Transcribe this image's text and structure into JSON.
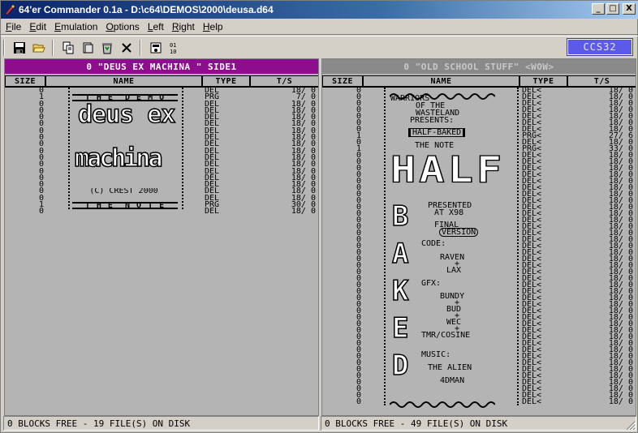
{
  "window": {
    "title": "64'er Commander 0.1a - D:\\c64\\DEMOS\\2000\\deusa.d64",
    "min": "_",
    "max": "□",
    "close": "X"
  },
  "menu": [
    "File",
    "Edit",
    "Emulation",
    "Options",
    "Left",
    "Right",
    "Help"
  ],
  "toolbar": {
    "badge": "CCS32"
  },
  "left": {
    "title": "0 \"DEUS EX MACHINA \" SIDE1",
    "headers": {
      "size": "SIZE",
      "name": "NAME",
      "type": "TYPE",
      "ts": "T/S"
    },
    "rows": [
      {
        "size": "0",
        "name": "",
        "type": "DEL",
        "ts": "18/ 0"
      },
      {
        "size": "1",
        "name": "T_H_E__D_E_M_O",
        "type": "PRG",
        "ts": "7/ 0"
      },
      {
        "size": "0",
        "name": "",
        "type": "DEL",
        "ts": "18/ 0"
      },
      {
        "size": "0",
        "name": "",
        "type": "DEL",
        "ts": "18/ 0"
      },
      {
        "size": "0",
        "name": "",
        "type": "DEL",
        "ts": "18/ 0"
      },
      {
        "size": "0",
        "name": "",
        "type": "DEL",
        "ts": "18/ 0"
      },
      {
        "size": "0",
        "name": "",
        "type": "DEL",
        "ts": "18/ 0"
      },
      {
        "size": "0",
        "name": "",
        "type": "DEL",
        "ts": "18/ 0"
      },
      {
        "size": "0",
        "name": "",
        "type": "DEL",
        "ts": "18/ 0"
      },
      {
        "size": "0",
        "name": "",
        "type": "DEL",
        "ts": "18/ 0"
      },
      {
        "size": "0",
        "name": "",
        "type": "DEL",
        "ts": "18/ 0"
      },
      {
        "size": "0",
        "name": "",
        "type": "DEL",
        "ts": "18/ 0"
      },
      {
        "size": "0",
        "name": "",
        "type": "DEL",
        "ts": "18/ 0"
      },
      {
        "size": "0",
        "name": "",
        "type": "DEL",
        "ts": "18/ 0"
      },
      {
        "size": "0",
        "name": "",
        "type": "DEL",
        "ts": "18/ 0"
      },
      {
        "size": "0",
        "name": "(C) CREST 2000",
        "type": "DEL",
        "ts": "18/ 0"
      },
      {
        "size": "0",
        "name": "",
        "type": "DEL",
        "ts": "18/ 0"
      },
      {
        "size": "1",
        "name": "T_H_E__N_O_T_E",
        "type": "PRG",
        "ts": "30/ 0"
      },
      {
        "size": "0",
        "name": "",
        "type": "DEL",
        "ts": "18/ 0"
      }
    ],
    "logo_top": "deus ex",
    "logo_bottom": "machina",
    "status": "0 BLOCKS FREE - 19 FILE(S) ON DISK"
  },
  "right": {
    "title": "0 \"OLD SCHOOL STUFF\" <WOW>",
    "headers": {
      "size": "SIZE",
      "name": "NAME",
      "type": "TYPE",
      "ts": "T/S"
    },
    "texts": {
      "l1": "WARRIORS",
      "l2": "OF THE",
      "l3": "WASTELAND",
      "l4": "PRESENTS:",
      "l5": "HALF-BAKED",
      "l6": "THE NOTE",
      "big": "HALF",
      "p1": "PRESENTED",
      "p2": "AT X98",
      "f1": "FINAL",
      "f2": "VERSION",
      "code": "CODE:",
      "raven": "RAVEN",
      "plus1": "+",
      "lax": "LAX",
      "gfx": "GFX:",
      "bundy": "BUNDY",
      "plus2": "+",
      "bud": "BUD",
      "plus3": "+",
      "wec": "WEC",
      "plus4": "+",
      "tmr": "TMR/COSINE",
      "music": "MUSIC:",
      "alien": "THE ALIEN",
      "dman": "4DMAN",
      "baked": "BAKED"
    },
    "ts_list": [
      "18/ 0",
      "18/ 0",
      "18/ 0",
      "18/ 0",
      "18/ 0",
      "18/ 0",
      "18/ 0",
      "27/ 6",
      "18/ 0",
      "33/ 0",
      "18/ 0",
      "18/ 0",
      "18/ 0",
      "18/ 0",
      "18/ 0",
      "18/ 0",
      "18/ 0",
      "18/ 0",
      "18/ 0",
      "18/ 0",
      "18/ 0",
      "18/ 0",
      "18/ 0",
      "18/ 0",
      "18/ 0",
      "18/ 0",
      "18/ 0",
      "18/ 0",
      "18/ 0",
      "18/ 0",
      "18/ 0",
      "18/ 0",
      "18/ 0",
      "18/ 0",
      "18/ 0",
      "18/ 0",
      "18/ 0",
      "18/ 0",
      "18/ 0",
      "18/ 0",
      "18/ 0",
      "18/ 0",
      "18/ 0",
      "18/ 0",
      "18/ 0",
      "18/ 0",
      "18/ 0",
      "18/ 0",
      "18/ 0"
    ],
    "type_list": [
      "DEL<",
      "DEL<",
      "DEL<",
      "DEL<",
      "DEL<",
      "DEL<",
      "DEL<",
      "PRG<",
      "DEL<",
      "PRG<",
      "DEL<",
      "DEL<",
      "DEL<",
      "DEL<",
      "DEL<",
      "DEL<",
      "DEL<",
      "DEL<",
      "DEL<",
      "DEL<",
      "DEL<",
      "DEL<",
      "DEL<",
      "DEL<",
      "DEL<",
      "DEL<",
      "DEL<",
      "DEL<",
      "DEL<",
      "DEL<",
      "DEL<",
      "DEL<",
      "DEL<",
      "DEL<",
      "DEL<",
      "DEL<",
      "DEL<",
      "DEL<",
      "DEL<",
      "DEL<",
      "DEL<",
      "DEL<",
      "DEL<",
      "DEL<",
      "DEL<",
      "DEL<",
      "DEL<",
      "DEL<",
      "DEL<"
    ],
    "size_list": [
      "0",
      "0",
      "0",
      "0",
      "0",
      "0",
      "0",
      "1",
      "0",
      "1",
      "0",
      "0",
      "0",
      "0",
      "0",
      "0",
      "0",
      "0",
      "0",
      "0",
      "0",
      "0",
      "0",
      "0",
      "0",
      "0",
      "0",
      "0",
      "0",
      "0",
      "0",
      "0",
      "0",
      "0",
      "0",
      "0",
      "0",
      "0",
      "0",
      "0",
      "0",
      "0",
      "0",
      "0",
      "0",
      "0",
      "0",
      "0",
      "0"
    ],
    "status": "0 BLOCKS FREE - 49 FILE(S) ON DISK"
  }
}
